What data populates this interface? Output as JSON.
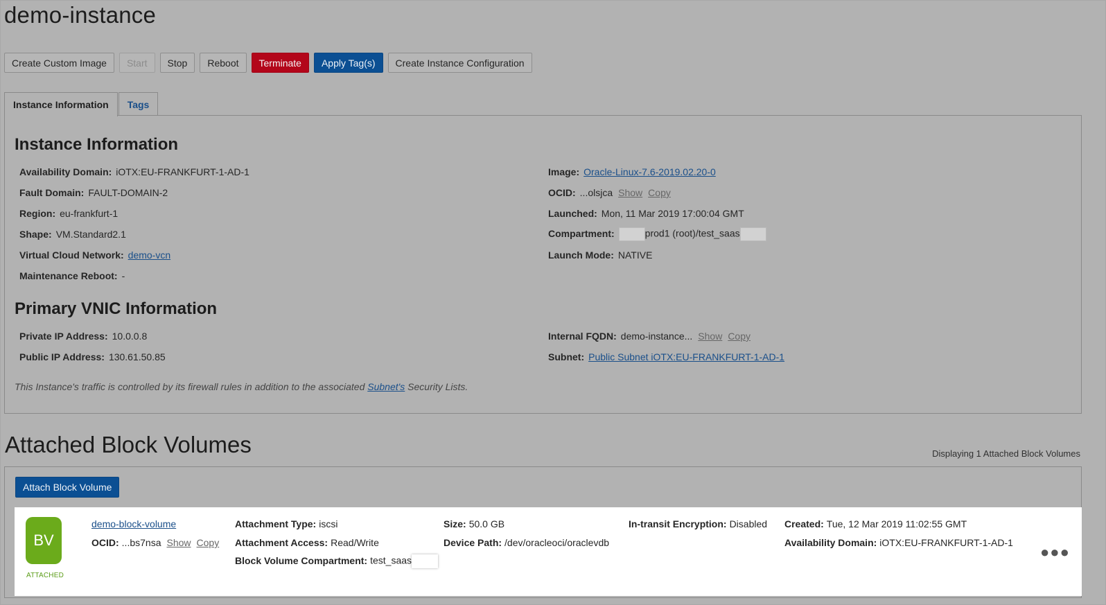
{
  "page": {
    "title": "demo-instance"
  },
  "toolbar": {
    "create_custom_image": "Create Custom Image",
    "start": "Start",
    "stop": "Stop",
    "reboot": "Reboot",
    "terminate": "Terminate",
    "apply_tags": "Apply Tag(s)",
    "create_instance_configuration": "Create Instance Configuration"
  },
  "tabs": {
    "instance_information": "Instance Information",
    "tags": "Tags"
  },
  "instance_info": {
    "heading": "Instance Information",
    "availability_domain": {
      "label": "Availability Domain:",
      "value": "iOTX:EU-FRANKFURT-1-AD-1"
    },
    "fault_domain": {
      "label": "Fault Domain:",
      "value": "FAULT-DOMAIN-2"
    },
    "region": {
      "label": "Region:",
      "value": "eu-frankfurt-1"
    },
    "shape": {
      "label": "Shape:",
      "value": "VM.Standard2.1"
    },
    "vcn": {
      "label": "Virtual Cloud Network:",
      "value": "demo-vcn"
    },
    "maintenance_reboot": {
      "label": "Maintenance Reboot:",
      "value": "-"
    },
    "image": {
      "label": "Image:",
      "value": "Oracle-Linux-7.6-2019.02.20-0"
    },
    "ocid": {
      "label": "OCID:",
      "value": "...olsjca",
      "show": "Show",
      "copy": "Copy"
    },
    "launched": {
      "label": "Launched:",
      "value": "Mon, 11 Mar 2019 17:00:04 GMT"
    },
    "compartment": {
      "label": "Compartment:",
      "value": "prod1 (root)/test_saas"
    },
    "launch_mode": {
      "label": "Launch Mode:",
      "value": "NATIVE"
    }
  },
  "vnic_info": {
    "heading": "Primary VNIC Information",
    "private_ip": {
      "label": "Private IP Address:",
      "value": "10.0.0.8"
    },
    "public_ip": {
      "label": "Public IP Address:",
      "value": "130.61.50.85"
    },
    "internal_fqdn": {
      "label": "Internal FQDN:",
      "value": "demo-instance...",
      "show": "Show",
      "copy": "Copy"
    },
    "subnet": {
      "label": "Subnet:",
      "value": "Public Subnet iOTX:EU-FRANKFURT-1-AD-1"
    },
    "note_prefix": "This Instance's traffic is controlled by its firewall rules in addition to the associated ",
    "note_link": "Subnet's",
    "note_suffix": " Security Lists."
  },
  "block_volumes": {
    "heading": "Attached Block Volumes",
    "count_text": "Displaying 1 Attached Block Volumes",
    "attach_button": "Attach Block Volume",
    "volume": {
      "icon_text": "BV",
      "status": "ATTACHED",
      "name": "demo-block-volume",
      "ocid_label": "OCID:",
      "ocid_value": "...bs7nsa",
      "show": "Show",
      "copy": "Copy",
      "attachment_type": {
        "label": "Attachment Type:",
        "value": "iscsi"
      },
      "attachment_access": {
        "label": "Attachment Access:",
        "value": "Read/Write"
      },
      "compartment": {
        "label": "Block Volume Compartment:",
        "value": "test_saas"
      },
      "size": {
        "label": "Size:",
        "value": "50.0 GB"
      },
      "device_path": {
        "label": "Device Path:",
        "value": "/dev/oracleoci/oraclevdb"
      },
      "encryption": {
        "label": "In-transit Encryption:",
        "value": "Disabled"
      },
      "created": {
        "label": "Created:",
        "value": "Tue, 12 Mar 2019 11:02:55 GMT"
      },
      "availability_domain": {
        "label": "Availability Domain:",
        "value": "iOTX:EU-FRANKFURT-1-AD-1"
      }
    }
  },
  "colors": {
    "background": "#b2b2b2",
    "danger": "#b3061a",
    "primary": "#0b4f93",
    "link": "#1a4f8a",
    "attached_green": "#6bab1b"
  },
  "icons": {
    "more": "more-horizontal-icon"
  }
}
